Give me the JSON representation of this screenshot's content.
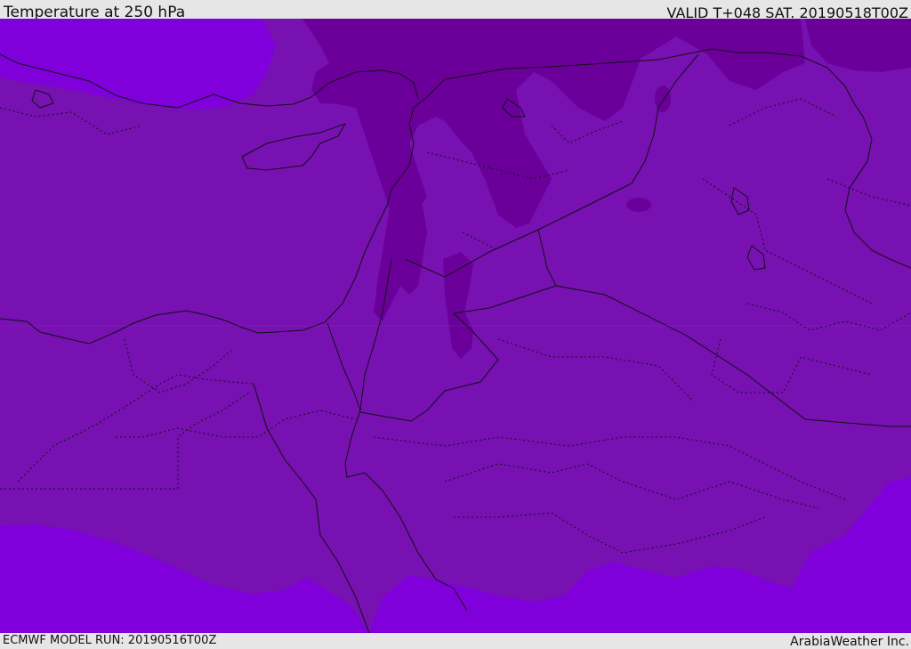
{
  "header": {
    "title": "Temperature at 250 hPa",
    "valid_time": "VALID T+048 SAT. 20190518T00Z"
  },
  "footer": {
    "model_run": "ECMWF MODEL RUN: 20190516T00Z",
    "brand": "ArabiaWeather Inc."
  },
  "colors": {
    "base_field": "#7711b2",
    "warm_field": "#7f00db",
    "cold_field": "#6a0099",
    "border_line": "#111111"
  }
}
